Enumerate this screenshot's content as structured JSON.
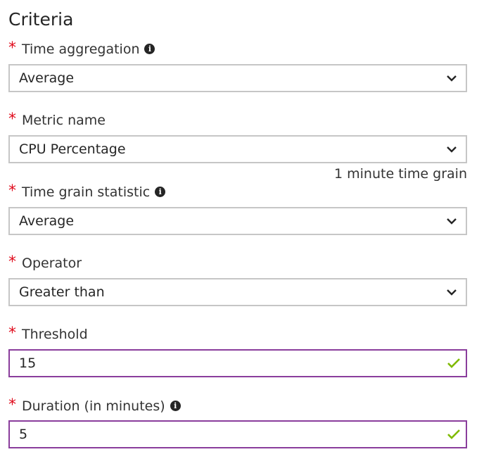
{
  "section_title": "Criteria",
  "required_mark": "*",
  "fields": {
    "time_aggregation": {
      "label": "Time aggregation",
      "value": "Average",
      "type": "dropdown",
      "info_icon": "info-icon"
    },
    "metric_name": {
      "label": "Metric name",
      "value": "CPU Percentage",
      "type": "dropdown",
      "hint": "1 minute time grain"
    },
    "time_grain_statistic": {
      "label": "Time grain statistic",
      "value": "Average",
      "type": "dropdown",
      "info_icon": "info-icon"
    },
    "operator": {
      "label": "Operator",
      "value": "Greater than",
      "type": "dropdown"
    },
    "threshold": {
      "label": "Threshold",
      "value": "15",
      "type": "text",
      "status": "valid"
    },
    "duration": {
      "label": "Duration (in minutes)",
      "value": "5",
      "type": "text",
      "status": "valid",
      "info_icon": "info-icon"
    }
  },
  "colors": {
    "required": "#e00b1c",
    "valid_border": "#8a3d9c",
    "valid_check": "#7fba00",
    "border": "#c6c6c6",
    "text": "#252525"
  }
}
